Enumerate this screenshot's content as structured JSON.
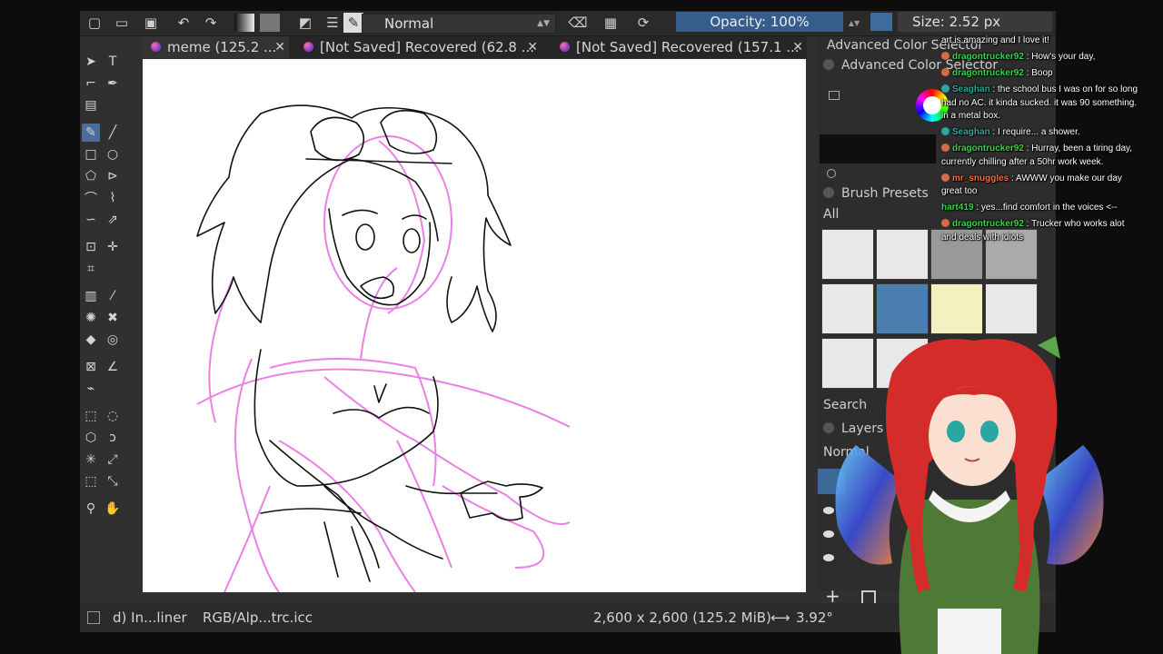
{
  "toolbar": {
    "blend_mode": "Normal",
    "opacity": "Opacity: 100%",
    "size": "Size: 2.52 px"
  },
  "tabs": [
    {
      "label": "meme (125.2 ..."
    },
    {
      "label": "[Not Saved]  Recovered (62.8 ..."
    },
    {
      "label": "[Not Saved]  Recovered (157.1 ..."
    }
  ],
  "dock": {
    "color_selector_title": "Advanced Color Selector",
    "color_selector_header": "Advanced Color Selector",
    "brush_presets_title": "Brush Presets",
    "brush_filter": "All",
    "search_label": "Search",
    "layers_title": "Layers",
    "layer_mode": "Normal"
  },
  "status": {
    "brush_name": "d) In...liner",
    "color_profile": "RGB/Alp...trc.icc",
    "dimensions": "2,600 x 2,600 (125.2 MiB)",
    "rotation": "3.92°"
  },
  "chat": [
    {
      "user": "",
      "user_color": "#ffffff",
      "text": "art is amazing and I love it!"
    },
    {
      "user": "dragontrucker92",
      "user_color": "#3cd24a",
      "text": "How's your day,"
    },
    {
      "user": "dragontrucker92",
      "user_color": "#3cd24a",
      "text": "Boop"
    },
    {
      "user": "Seaghan",
      "user_color": "#2ea7a0",
      "text": "the school bus I was on for so long had no AC. it kinda sucked. it was 90 something. in a metal box."
    },
    {
      "user": "Seaghan",
      "user_color": "#2ea7a0",
      "text": "I require... a shower."
    },
    {
      "user": "dragontrucker92",
      "user_color": "#3cd24a",
      "text": "Hurray, been a tiring day, currently chilling after a 50hr work week."
    },
    {
      "user": "mr_snuggles",
      "user_color": "#f0704a",
      "text": "AWWW you make our day great too"
    },
    {
      "user": "hart419",
      "user_color": "#3cd24a",
      "text": "yes...find comfort in the voices <--"
    },
    {
      "user": "dragontrucker92",
      "user_color": "#3cd24a",
      "text": "Trucker who works alot and deals with idiots"
    }
  ],
  "colors": {
    "accent": "#375e8a",
    "sketch_pink": "#e86ae0",
    "avatar_hair": "#d42b2b",
    "avatar_dress": "#4f7a35"
  }
}
